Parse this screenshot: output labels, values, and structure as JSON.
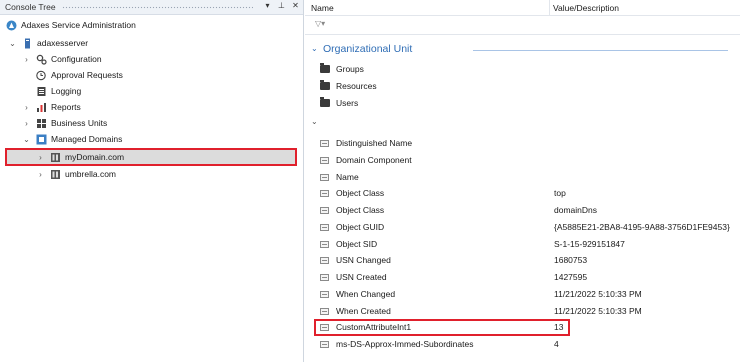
{
  "console_tree": {
    "title": "Console Tree",
    "controls": [
      "▾",
      "⊥",
      "✕"
    ]
  },
  "tree": {
    "root": "Adaxes Service Administration",
    "server": "adaxesserver",
    "children": [
      {
        "label": "Configuration",
        "icon": "gears-icon"
      },
      {
        "label": "Approval Requests",
        "icon": "approval-icon"
      },
      {
        "label": "Logging",
        "icon": "logging-icon"
      },
      {
        "label": "Reports",
        "icon": "reports-icon"
      },
      {
        "label": "Business Units",
        "icon": "business-units-icon"
      },
      {
        "label": "Managed Domains",
        "icon": "managed-domains-icon"
      }
    ],
    "domains": [
      {
        "label": "myDomain.com",
        "selected": true
      },
      {
        "label": "umbrella.com",
        "selected": false
      }
    ]
  },
  "columns": {
    "name": "Name",
    "value": "Value/Description",
    "filter": "▽▾"
  },
  "ou_section": {
    "title": "Organizational Unit",
    "folders": [
      "Groups",
      "Resources",
      "Users"
    ]
  },
  "properties": [
    {
      "name": "Distinguished Name",
      "value": ""
    },
    {
      "name": "Domain Component",
      "value": ""
    },
    {
      "name": "Name",
      "value": ""
    },
    {
      "name": "Object Class",
      "value": "top"
    },
    {
      "name": "Object Class",
      "value": "domainDns"
    },
    {
      "name": "Object GUID",
      "value": "{A5885E21-2BA8-4195-9A88-3756D1FE9453}"
    },
    {
      "name": "Object SID",
      "value": "S-1-15-929151847"
    },
    {
      "name": "USN Changed",
      "value": "1680753"
    },
    {
      "name": "USN Created",
      "value": "1427595"
    },
    {
      "name": "When Changed",
      "value": "11/21/2022 5:10:33 PM"
    },
    {
      "name": "When Created",
      "value": "11/21/2022 5:10:33 PM"
    },
    {
      "name": "CustomAttributeInt1",
      "value": "13"
    },
    {
      "name": "ms-DS-Approx-Immed-Subordinates",
      "value": "4"
    }
  ],
  "colors": {
    "accent": "#2f6db5",
    "highlight": "#e0202c"
  }
}
